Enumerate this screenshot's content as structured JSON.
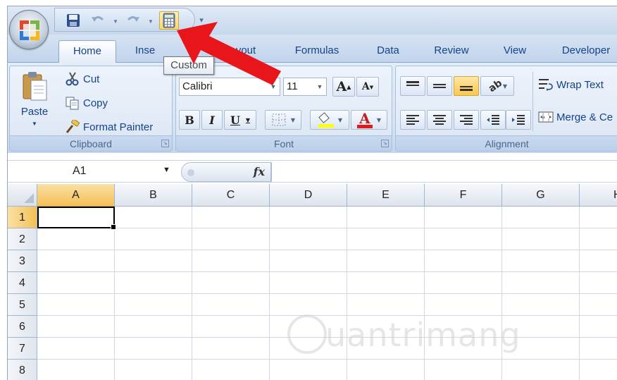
{
  "quick_access": {
    "save_icon": "save-icon",
    "undo_icon": "undo-icon",
    "redo_icon": "redo-icon",
    "custom_icon": "calculator-icon",
    "customize_icon": "customize-qat-icon"
  },
  "tooltip": {
    "text": "Custom"
  },
  "tabs": [
    {
      "label": "Home",
      "active": true
    },
    {
      "label": "Inse"
    },
    {
      "label": "yout"
    },
    {
      "label": "Formulas"
    },
    {
      "label": "Data"
    },
    {
      "label": "Review"
    },
    {
      "label": "View"
    },
    {
      "label": "Developer"
    }
  ],
  "clipboard": {
    "paste_label": "Paste",
    "cut_label": "Cut",
    "copy_label": "Copy",
    "format_painter_label": "Format Painter",
    "group_label": "Clipboard"
  },
  "font": {
    "font_name": "Calibri",
    "font_size": "11",
    "bold": "B",
    "italic": "I",
    "underline": "U",
    "grow_font": "A",
    "shrink_font": "A",
    "font_color": "A",
    "group_label": "Font"
  },
  "alignment": {
    "wrap_text_label": "Wrap Text",
    "merge_label": "Merge & Ce",
    "group_label": "Alignment"
  },
  "formula_bar": {
    "name_box_value": "A1",
    "fx_label": "fx",
    "formula_value": ""
  },
  "sheet": {
    "columns": [
      "A",
      "B",
      "C",
      "D",
      "E",
      "F",
      "G",
      "H"
    ],
    "rows": [
      "1",
      "2",
      "3",
      "4",
      "5",
      "6",
      "7",
      "8"
    ],
    "active_cell": "A1"
  },
  "watermark": {
    "text": "uantrimang"
  },
  "colors": {
    "ribbon_bg": "#d6e3f3",
    "tab_text": "#15428b",
    "selection_header": "#f4c056",
    "arrow": "#e8161b",
    "font_color_bar": "#e31a1c",
    "highlight_bar": "#ffff00"
  }
}
